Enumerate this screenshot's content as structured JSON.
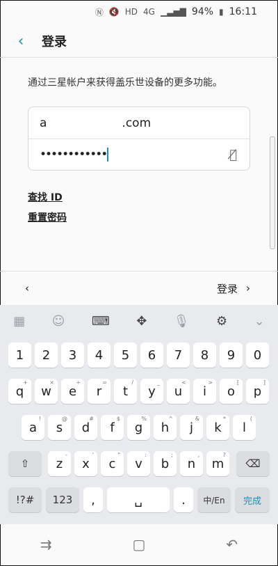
{
  "status": {
    "battery": "94%",
    "time": "16:11",
    "signal_label": "4G"
  },
  "header": {
    "title": "登录"
  },
  "subtitle": "通过三星帐户来获得盖乐世设备的更多功能。",
  "account": {
    "email_prefix": "a",
    "email_suffix": ".com",
    "password_mask": "••••••••••••"
  },
  "links": {
    "find_id": "查找 ID",
    "reset_password": "重置密码"
  },
  "bottom": {
    "next_label": "登录"
  },
  "keyboard": {
    "numbers": [
      "1",
      "2",
      "3",
      "4",
      "5",
      "6",
      "7",
      "8",
      "9",
      "0"
    ],
    "row1": [
      "q",
      "w",
      "e",
      "r",
      "t",
      "y",
      "u",
      "i",
      "o",
      "p"
    ],
    "row1_hints": [
      "+",
      "×",
      "÷",
      "=",
      "/",
      "_",
      "<",
      ">",
      "[",
      "]"
    ],
    "row2": [
      "a",
      "s",
      "d",
      "f",
      "g",
      "h",
      "j",
      "k",
      "l"
    ],
    "row2_hints": [
      "!",
      "@",
      "#",
      "$",
      "%",
      "^",
      "&",
      "*",
      "("
    ],
    "row3": [
      "z",
      "x",
      "c",
      "v",
      "b",
      "n",
      "m"
    ],
    "row3_hints": [
      "-",
      "'",
      "\"",
      ":",
      ";",
      ",",
      "?"
    ],
    "symbols_label": "!?#",
    "numbers_label": "123",
    "comma": ",",
    "period": ".",
    "lang_label": "中/En",
    "done_label": "完成"
  }
}
